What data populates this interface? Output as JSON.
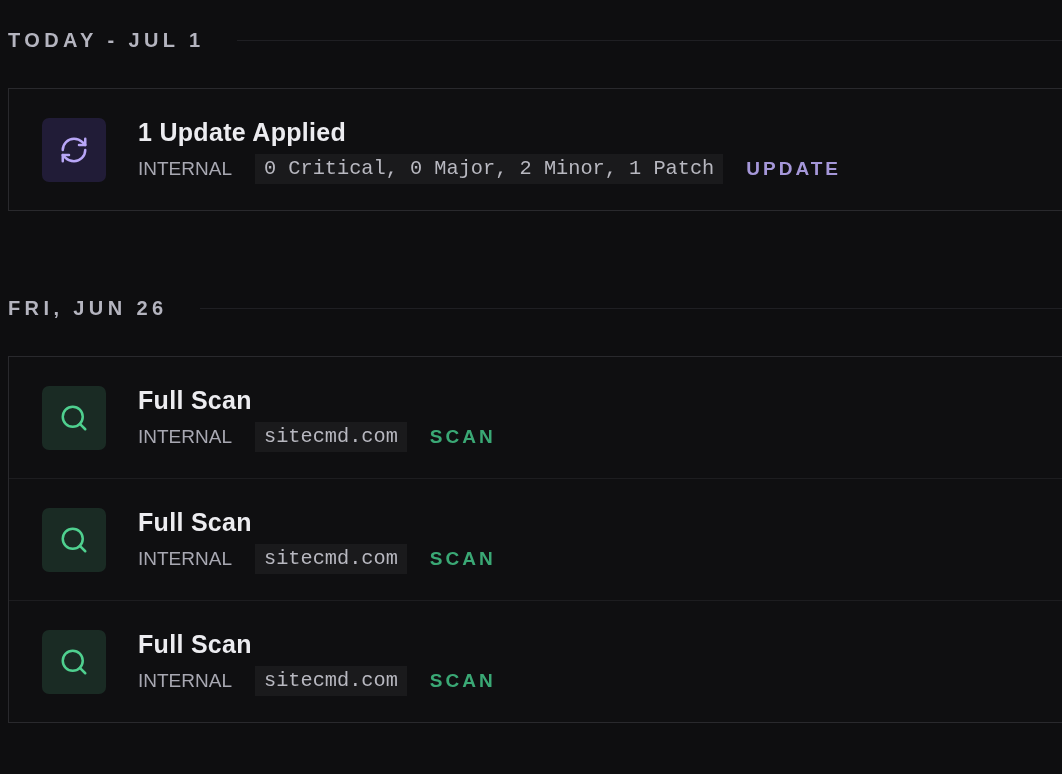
{
  "sections": [
    {
      "heading": "TODAY - JUL 1",
      "events": [
        {
          "kind": "update",
          "title": "1 Update Applied",
          "source": "INTERNAL",
          "detail": "0 Critical, 0 Major, 2 Minor, 1 Patch",
          "tag": "UPDATE"
        }
      ]
    },
    {
      "heading": "FRI, JUN 26",
      "events": [
        {
          "kind": "scan",
          "title": "Full Scan",
          "source": "INTERNAL",
          "detail": "sitecmd.com",
          "tag": "SCAN"
        },
        {
          "kind": "scan",
          "title": "Full Scan",
          "source": "INTERNAL",
          "detail": "sitecmd.com",
          "tag": "SCAN"
        },
        {
          "kind": "scan",
          "title": "Full Scan",
          "source": "INTERNAL",
          "detail": "sitecmd.com",
          "tag": "SCAN"
        }
      ]
    }
  ]
}
